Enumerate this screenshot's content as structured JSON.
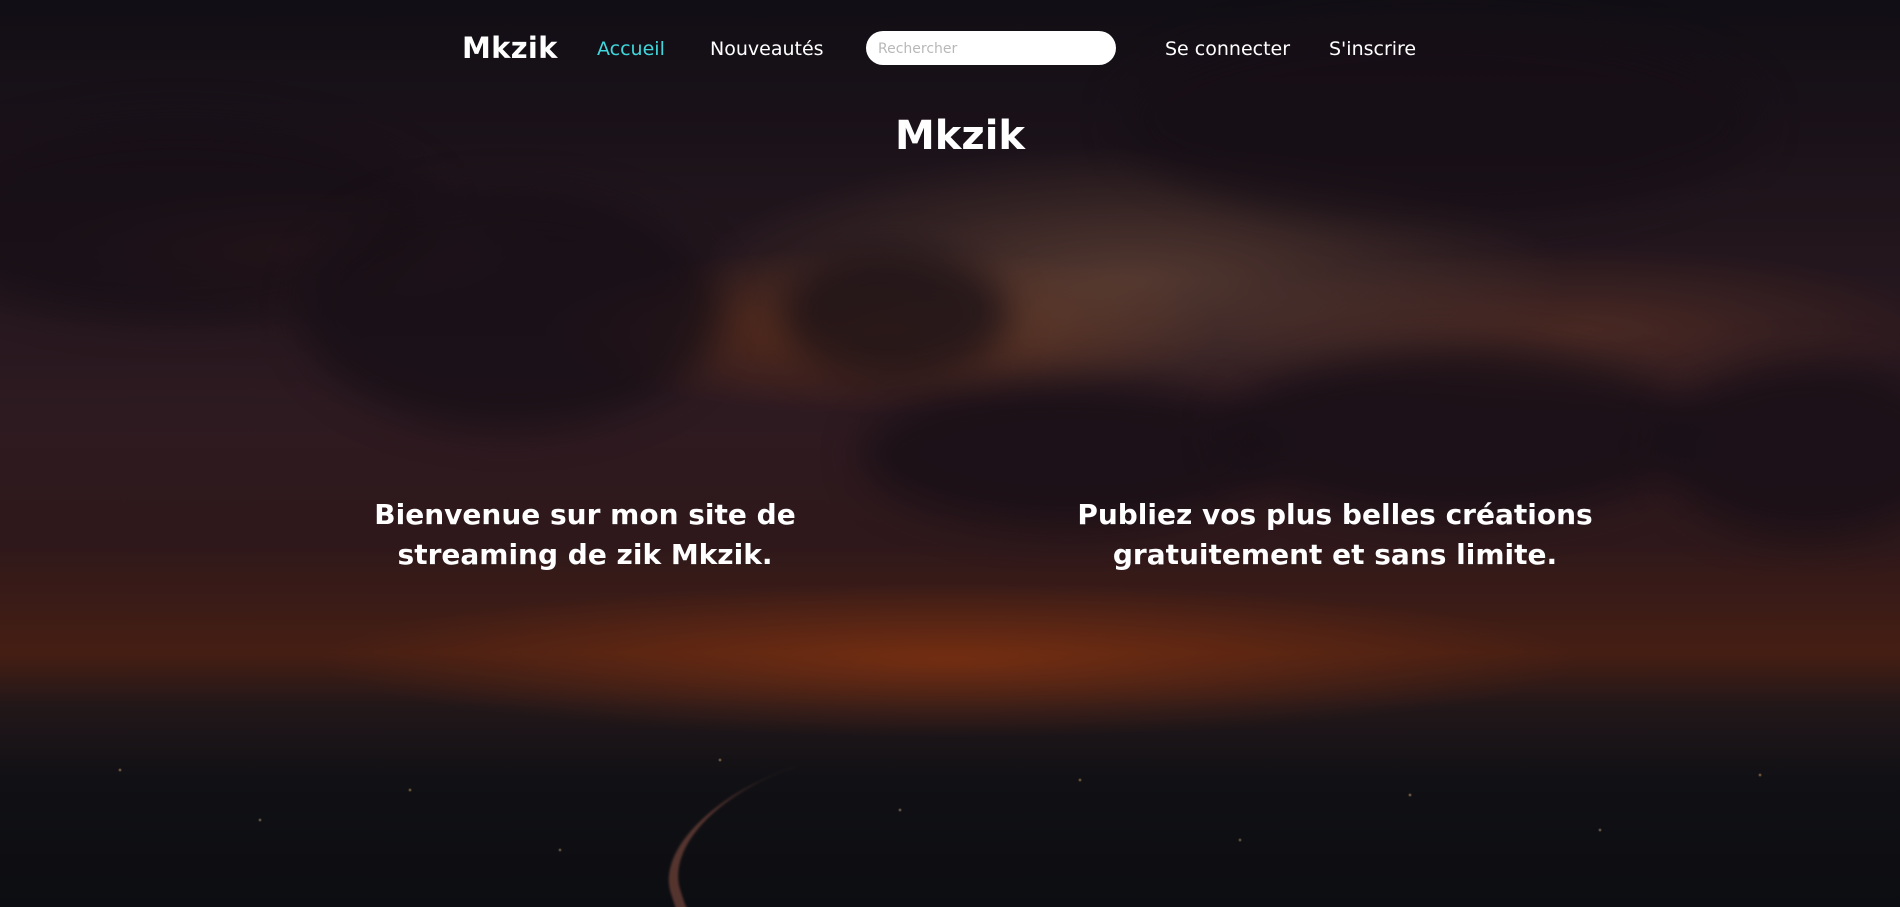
{
  "nav": {
    "brand": "Mkzik",
    "home": "Accueil",
    "news": "Nouveautés",
    "search_placeholder": "Rechercher",
    "login": "Se connecter",
    "signup": "S'inscrire"
  },
  "hero": {
    "title": "Mkzik",
    "tagline_left": "Bienvenue sur mon site de streaming de zik Mkzik.",
    "tagline_right": "Publiez vos plus belles créations gratuitement et sans limite."
  },
  "colors": {
    "accent": "#3fd7dc",
    "text": "#ffffff"
  }
}
